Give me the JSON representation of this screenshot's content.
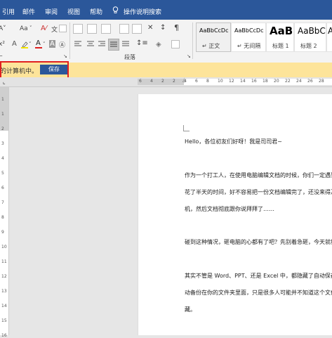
{
  "menu": {
    "items": [
      "引用",
      "邮件",
      "审阅",
      "视图",
      "帮助",
      "操作说明搜索"
    ]
  },
  "ribbon": {
    "font_size_label": "Aa",
    "phonetic_label": "文",
    "group_paragraph": "段落",
    "styles": [
      {
        "sample": "AaBbCcDc",
        "name": "↵ 正文"
      },
      {
        "sample": "AaBbCcDc",
        "name": "↵ 无间隔"
      },
      {
        "sample": "AaBl",
        "name": "标题 1"
      },
      {
        "sample": "AaBbC",
        "name": "标题 2"
      },
      {
        "sample": "A",
        "name": ""
      }
    ]
  },
  "notification": {
    "message": "的计算机中。",
    "save_label": "保存"
  },
  "ruler": {
    "top_numbers": [
      "6",
      "4",
      "2",
      "2",
      "4",
      "6",
      "8",
      "10",
      "12",
      "14",
      "16",
      "18",
      "20",
      "22",
      "24",
      "26",
      "28"
    ],
    "left_numbers": [
      "1",
      "1",
      "2",
      "3",
      "4",
      "5",
      "6",
      "7",
      "8",
      "9",
      "10",
      "11",
      "12",
      "13",
      "14",
      "15",
      "16"
    ]
  },
  "document": {
    "paragraphs": [
      "Hello，各位初友们好呀！我是司司君~",
      "作为一个打工人，在使用电脑编辑文档的时候，你们一定遇到",
      "花了半天的时间，好不容易把一份文档编辑完了，还没来得及",
      "机，然后文档彻底跟你说拜拜了……",
      "碰到这种情况，砸电脑的心都有了吧？先别着急砸，今天就教大",
      "其实不管是 Word、PPT、还是 Excel 中，都隐藏了自动保存",
      "动备份在你的文件夹里面，只是很多人可能并不知道这个文件",
      "藏。"
    ]
  },
  "colors": {
    "ribbon_blue": "#2b579a",
    "notification_bg": "#fde49a",
    "highlight_red": "#e02020"
  }
}
